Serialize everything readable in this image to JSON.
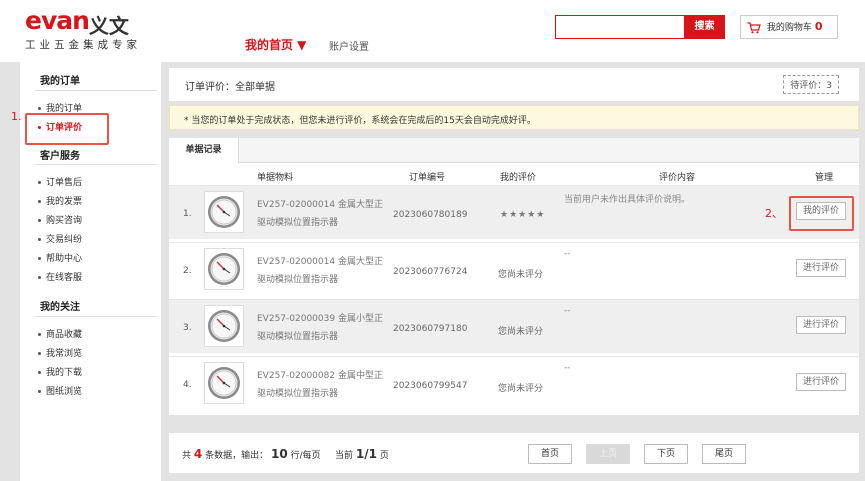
{
  "header": {
    "logo_text": "evan",
    "logo_cn": "义文",
    "logo_sub": "工业五金集成专家",
    "nav_home": "我的首页 ▼",
    "nav_account": "账户设置",
    "search_placeholder": "",
    "search_button": "搜索",
    "cart_label": "我的购物车",
    "cart_count": "0"
  },
  "sidebar": {
    "sections": [
      {
        "title": "我的订单",
        "items": [
          "我的订单",
          "订单评价"
        ]
      },
      {
        "title": "客户服务",
        "items": [
          "订单售后",
          "我的发票",
          "购买咨询",
          "交易纠纷",
          "帮助中心",
          "在线客服"
        ]
      },
      {
        "title": "我的关注",
        "items": [
          "商品收藏",
          "我常浏览",
          "我的下载",
          "图纸浏览"
        ]
      }
    ],
    "active_item": "订单评价"
  },
  "content": {
    "title": "订单评价：全部单据",
    "pending": "待评价：3",
    "notice": "* 当您的订单处于完成状态，但您未进行评价，系统会在完成后的15天会自动完成好评。",
    "tab": "单据记录",
    "columns": [
      "单据物料",
      "订单编号",
      "我的评价",
      "评价内容",
      "管理"
    ],
    "rows": [
      {
        "index": "1.",
        "product_line1": "EV257-02000014 金属大型正",
        "product_line2": "驱动模拟位置指示器",
        "order_no": "2023060780189",
        "rating": "★★★★★",
        "comment": "当前用户未作出具体评价说明。",
        "action": "我的评价"
      },
      {
        "index": "2.",
        "product_line1": "EV257-02000014 金属大型正",
        "product_line2": "驱动模拟位置指示器",
        "order_no": "2023060776724",
        "rating": "您尚未评分",
        "comment": "--",
        "action": "进行评价"
      },
      {
        "index": "3.",
        "product_line1": "EV257-02000039 金属小型正",
        "product_line2": "驱动模拟位置指示器",
        "order_no": "2023060797180",
        "rating": "您尚未评分",
        "comment": "--",
        "action": "进行评价"
      },
      {
        "index": "4.",
        "product_line1": "EV257-02000082 金属中型正",
        "product_line2": "驱动模拟位置指示器",
        "order_no": "2023060799547",
        "rating": "您尚未评分",
        "comment": "--",
        "action": "进行评价"
      }
    ]
  },
  "pager": {
    "total_prefix": "共",
    "total": "4",
    "total_suffix": "条数据，输出：",
    "per_page": "10",
    "per_page_suffix": "行/每页",
    "current_prefix": "当前",
    "current": "1/1",
    "current_suffix": "页",
    "buttons": [
      "首页",
      "上页",
      "下页",
      "尾页"
    ]
  },
  "annotations": {
    "label1": "1.",
    "label2": "2、"
  },
  "colors": {
    "brand_red": "#d61518",
    "annotation_red": "#e8534a"
  }
}
